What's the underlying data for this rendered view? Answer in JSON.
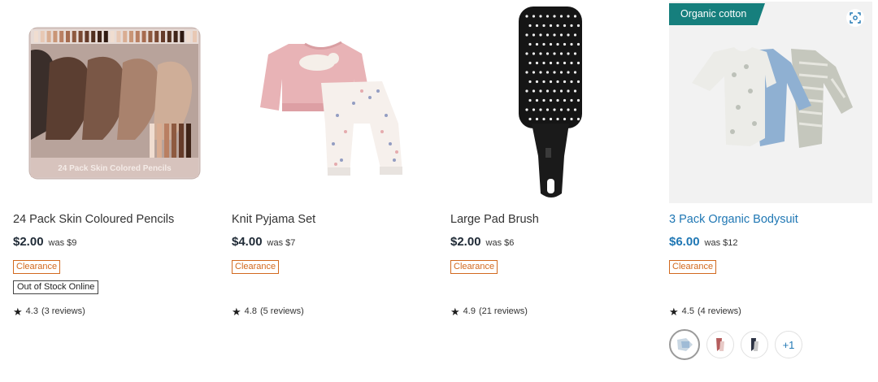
{
  "products": [
    {
      "name": "24 Pack Skin Coloured Pencils",
      "price": "$2.00",
      "was": "was $9",
      "clearance": "Clearance",
      "stock": "Out of Stock Online",
      "rating": "4.3",
      "reviews": "(3 reviews)",
      "tin_text": "24 Pack Skin Colored Pencils"
    },
    {
      "name": "Knit Pyjama Set",
      "price": "$4.00",
      "was": "was $7",
      "clearance": "Clearance",
      "rating": "4.8",
      "reviews": "(5 reviews)"
    },
    {
      "name": "Large Pad Brush",
      "price": "$2.00",
      "was": "was $6",
      "clearance": "Clearance",
      "rating": "4.9",
      "reviews": "(21 reviews)"
    },
    {
      "name": "3 Pack Organic Bodysuit",
      "price": "$6.00",
      "was": "was $12",
      "clearance": "Clearance",
      "rating": "4.5",
      "reviews": "(4 reviews)",
      "ribbon": "Organic cotton",
      "more_colours": "+1"
    }
  ],
  "icons": {
    "star": "star-icon",
    "scan": "image-search-icon"
  },
  "colors": {
    "clearance": "#d2691e",
    "link_blue": "#1f77b4",
    "ribbon_teal": "#167f7d"
  }
}
